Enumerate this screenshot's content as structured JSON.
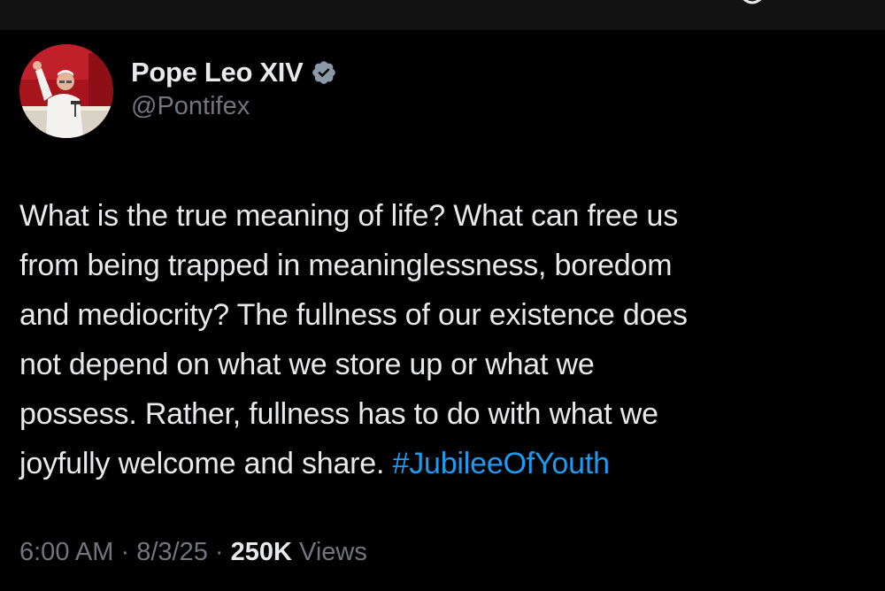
{
  "user": {
    "display_name": "Pope Leo XIV",
    "handle": "@Pontifex",
    "verified": true,
    "verified_color": "#8b98a5"
  },
  "tweet": {
    "lines": [
      "What is the true meaning of life?  What can free us",
      "from being trapped in meaninglessness, boredom",
      "and mediocrity? The fullness of our existence does",
      "not depend on what we store up or what we",
      "possess. Rather, fullness has to do with what we",
      "joyfully welcome and share. "
    ],
    "hashtag": "#JubileeOfYouth",
    "hashtag_color": "#1d9bf0"
  },
  "meta": {
    "time": "6:00 AM",
    "separator": "·",
    "date": "8/3/25",
    "views_count": "250K",
    "views_label": "Views"
  },
  "colors": {
    "background": "#000000",
    "text": "#e7e9ea",
    "secondary_text": "#71767b"
  }
}
